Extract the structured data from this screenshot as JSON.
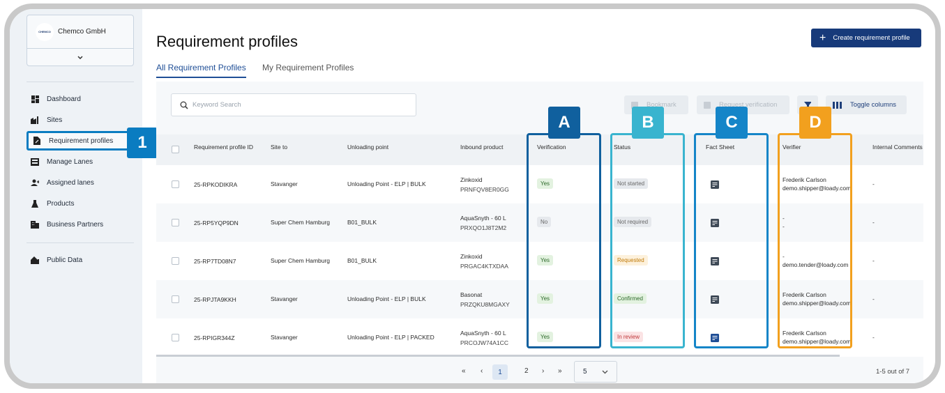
{
  "org": {
    "logo_text": "CHEMCO",
    "name": "Chemco GmbH",
    "expand_icon": "chevron-down-icon"
  },
  "nav": {
    "items": [
      {
        "label": "Dashboard",
        "icon": "dashboard-icon"
      },
      {
        "label": "Sites",
        "icon": "factory-icon"
      },
      {
        "label": "Requirement profiles",
        "icon": "document-edit-icon"
      },
      {
        "label": "Manage Lanes",
        "icon": "lanes-icon"
      },
      {
        "label": "Assigned lanes",
        "icon": "person-add-icon"
      },
      {
        "label": "Products",
        "icon": "flask-icon"
      },
      {
        "label": "Business Partners",
        "icon": "building-icon"
      }
    ],
    "secondary": [
      {
        "label": "Public Data",
        "icon": "public-icon"
      }
    ],
    "callout": "1"
  },
  "page": {
    "title": "Requirement profiles",
    "create_button": "Create requirement profile"
  },
  "tabs": [
    {
      "label": "All Requirement Profiles",
      "active": true
    },
    {
      "label": "My Requirement Profiles",
      "active": false
    }
  ],
  "toolbar": {
    "search_placeholder": "Keyword Search",
    "bookmark": "Bookmark",
    "request_verification": "Request verification",
    "toggle_columns": "Toggle columns"
  },
  "table": {
    "columns": [
      "Requirement profile ID",
      "Site to",
      "Unloading point",
      "Inbound product",
      "Verification",
      "Status",
      "Fact Sheet",
      "Verifier",
      "Internal Comments"
    ],
    "rows": [
      {
        "id": "25-RPKODIKRA",
        "site": "Stavanger",
        "unloading": "Unloading Point - ELP | BULK",
        "product": "Zinkoxid",
        "product_code": "PRNFQV8ER0GG",
        "verification": "Yes",
        "status": "Not started",
        "verifier_name": "Frederik Carlson",
        "verifier_email": "demo.shipper@loady.com",
        "comments": "-"
      },
      {
        "id": "25-RP5YQP9DN",
        "site": "Super Chem Hamburg",
        "unloading": "B01_BULK",
        "product": "AquaSnyth - 60 L",
        "product_code": "PRXQO1J8T2M2",
        "verification": "No",
        "status": "Not required",
        "verifier_name": "-",
        "verifier_email": "-",
        "comments": "-"
      },
      {
        "id": "25-RP7TD08N7",
        "site": "Super Chem Hamburg",
        "unloading": "B01_BULK",
        "product": "Zinkoxid",
        "product_code": "PRGAC4KTXDAA",
        "verification": "Yes",
        "status": "Requested",
        "verifier_name": "-",
        "verifier_email": "demo.tender@loady.com",
        "comments": "-"
      },
      {
        "id": "25-RPJTA9KKH",
        "site": "Stavanger",
        "unloading": "Unloading Point - ELP | BULK",
        "product": "Basonat",
        "product_code": "PRZQKU8MGAXY",
        "verification": "Yes",
        "status": "Confirmed",
        "verifier_name": "Frederik Carlson",
        "verifier_email": "demo.shipper@loady.com",
        "comments": "-"
      },
      {
        "id": "25-RPIGR344Z",
        "site": "Stavanger",
        "unloading": "Unloading Point - ELP | PACKED",
        "product": "AquaSnyth - 60 L",
        "product_code": "PRCOJW74A1CC",
        "verification": "Yes",
        "status": "In review",
        "verifier_name": "Frederik Carlson",
        "verifier_email": "demo.shipper@loady.com",
        "comments": "-"
      }
    ]
  },
  "callouts": {
    "a": "A",
    "b": "B",
    "c": "C",
    "d": "D"
  },
  "colors": {
    "callout_1_A": "#0a7cc1",
    "callout_A": "#10609e",
    "callout_B": "#39b4cf",
    "callout_C": "#1585c8",
    "callout_D": "#f2a01e",
    "primary": "#173a7a"
  },
  "pagination": {
    "first": "«",
    "prev": "‹",
    "current": "1",
    "page2": "2",
    "next": "›",
    "last": "»",
    "per_page": "5",
    "summary": "1-5 out of 7"
  }
}
